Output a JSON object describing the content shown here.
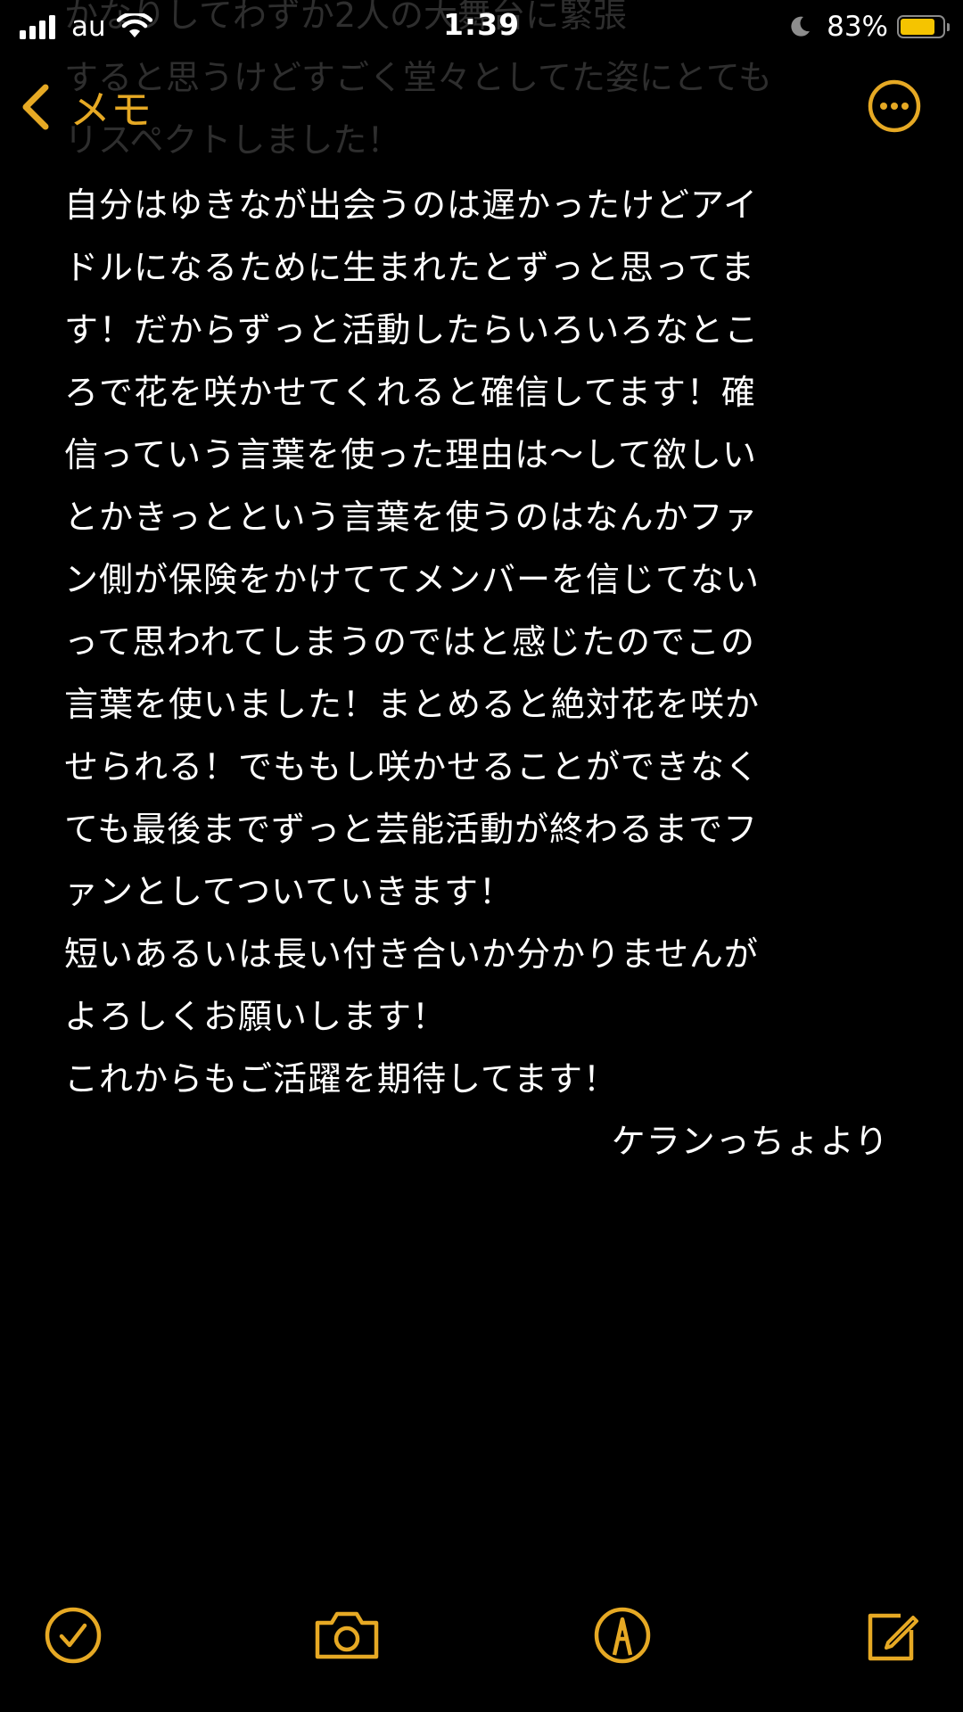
{
  "status_bar": {
    "carrier": "au",
    "time": "1:39",
    "battery_percent": "83%",
    "battery_level": 0.83,
    "signal_bars": 4,
    "icons": [
      "signal-icon",
      "wifi-icon",
      "moon-icon",
      "battery-icon"
    ]
  },
  "nav": {
    "back_label": "メモ",
    "more_icon": "ellipsis-circle-icon"
  },
  "note": {
    "ghost_lines": [
      "かなりしてわずか2人の大舞台に緊張",
      "すると思うけどすごく堂々としてた姿にとても",
      "リスペクトしました！"
    ],
    "lines": [
      "自分はゆきなが出会うのは遅かったけどアイ",
      "ドルになるために生まれたとずっと思ってま",
      "す！だからずっと活動したらいろいろなとこ",
      "ろで花を咲かせてくれると確信してます！確",
      "信っていう言葉を使った理由は〜して欲しい",
      "とかきっとという言葉を使うのはなんかファ",
      "ン側が保険をかけててメンバーを信じてない",
      "って思われてしまうのではと感じたのでこの",
      "言葉を使いました！まとめると絶対花を咲か",
      "せられる！でももし咲かせることができなく",
      "ても最後までずっと芸能活動が終わるまでフ",
      "ァンとしてついていきます！",
      "短いあるいは長い付き合いか分かりませんが",
      "よろしくお願いします！",
      "これからもご活躍を期待してます！"
    ],
    "signature": "ケランっちょより"
  },
  "toolbar": {
    "icons": [
      "checklist-icon",
      "camera-icon",
      "markup-icon",
      "compose-icon"
    ]
  },
  "colors": {
    "accent": "#e6a924",
    "background": "#000000",
    "text": "#ffffff",
    "battery": "#f5c400"
  }
}
